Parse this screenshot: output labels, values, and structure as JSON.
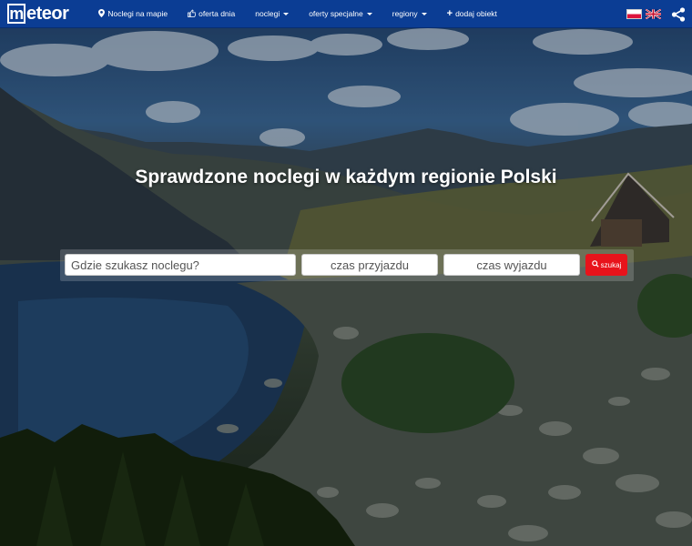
{
  "brand": {
    "name": "meteor",
    "mark": "m",
    "rest": "eteor"
  },
  "nav": {
    "items": [
      {
        "label": "Noclegi na mapie",
        "icon": "map-marker-icon",
        "dropdown": false
      },
      {
        "label": "oferta dnia",
        "icon": "thumbs-up-icon",
        "dropdown": false
      },
      {
        "label": "noclegi",
        "icon": null,
        "dropdown": true
      },
      {
        "label": "oferty specjalne",
        "icon": null,
        "dropdown": true
      },
      {
        "label": "regiony",
        "icon": null,
        "dropdown": true
      },
      {
        "label": "dodaj obiekt",
        "icon": "plus-icon",
        "dropdown": false
      }
    ],
    "languages": [
      "pl-flag-icon",
      "uk-flag-icon"
    ],
    "share_icon": "share-icon"
  },
  "hero": {
    "title": "Sprawdzone noclegi w każdym regionie Polski"
  },
  "search": {
    "where_placeholder": "Gdzie szukasz noclegu?",
    "arrival_placeholder": "czas przyjazdu",
    "departure_placeholder": "czas wyjazdu",
    "button_label": "szukaj",
    "button_icon": "search-icon"
  },
  "colors": {
    "navbar": "#0b3d94",
    "search_button": "#e8131b"
  }
}
